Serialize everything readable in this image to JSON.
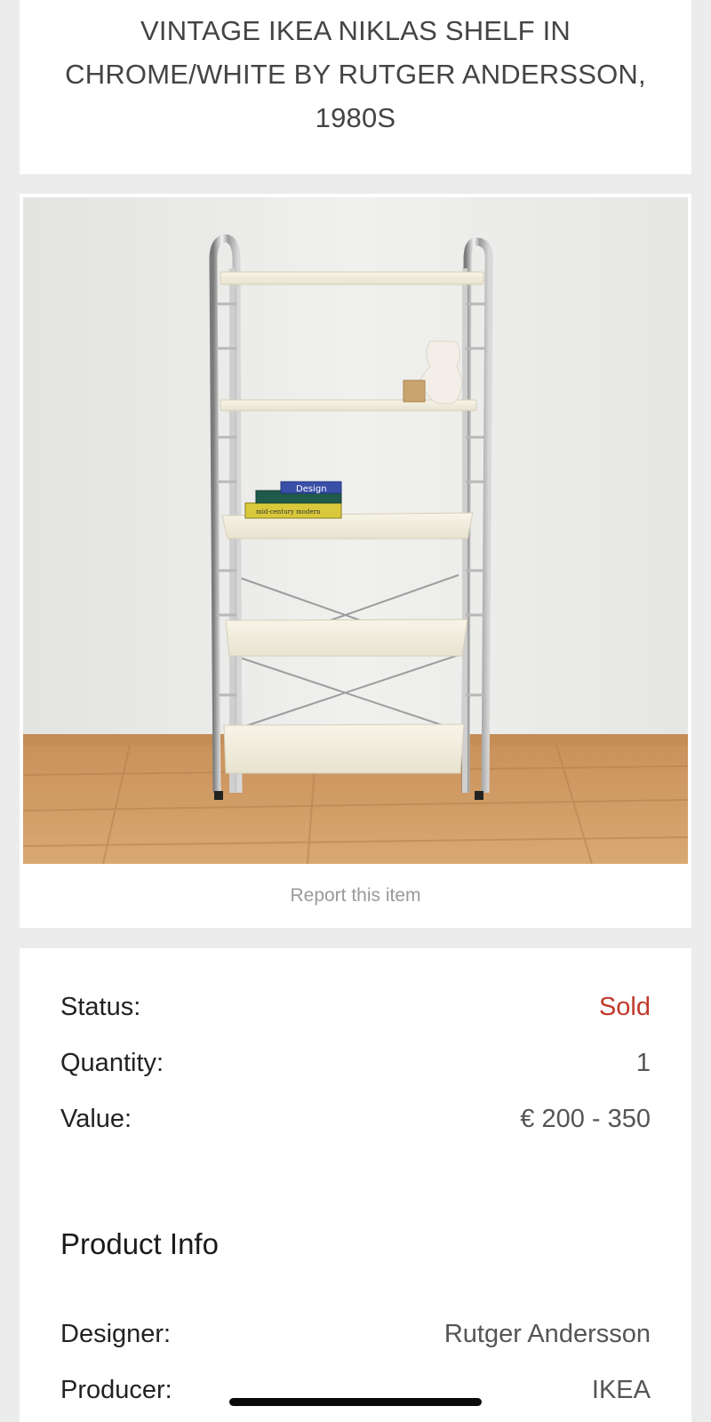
{
  "listing": {
    "title": "VINTAGE IKEA NIKLAS SHELF IN CHROME/WHITE BY RUTGER ANDERSSON, 1980S"
  },
  "image": {
    "alt": "Chrome and white IKEA Niklas shelf standing against a white wall on a wooden floor"
  },
  "actions": {
    "report_label": "Report this item"
  },
  "details": {
    "status_label": "Status:",
    "status_value": "Sold",
    "quantity_label": "Quantity:",
    "quantity_value": "1",
    "value_label": "Value:",
    "value_value": "€ 200 - 350"
  },
  "product_info": {
    "heading": "Product Info",
    "designer_label": "Designer:",
    "designer_value": "Rutger Andersson",
    "producer_label": "Producer:",
    "producer_value": "IKEA"
  },
  "book_labels": {
    "top": "Design",
    "bottom": "mid-century modern"
  },
  "colors": {
    "sold": "#c0392b",
    "background": "#ececec",
    "card": "#ffffff"
  }
}
